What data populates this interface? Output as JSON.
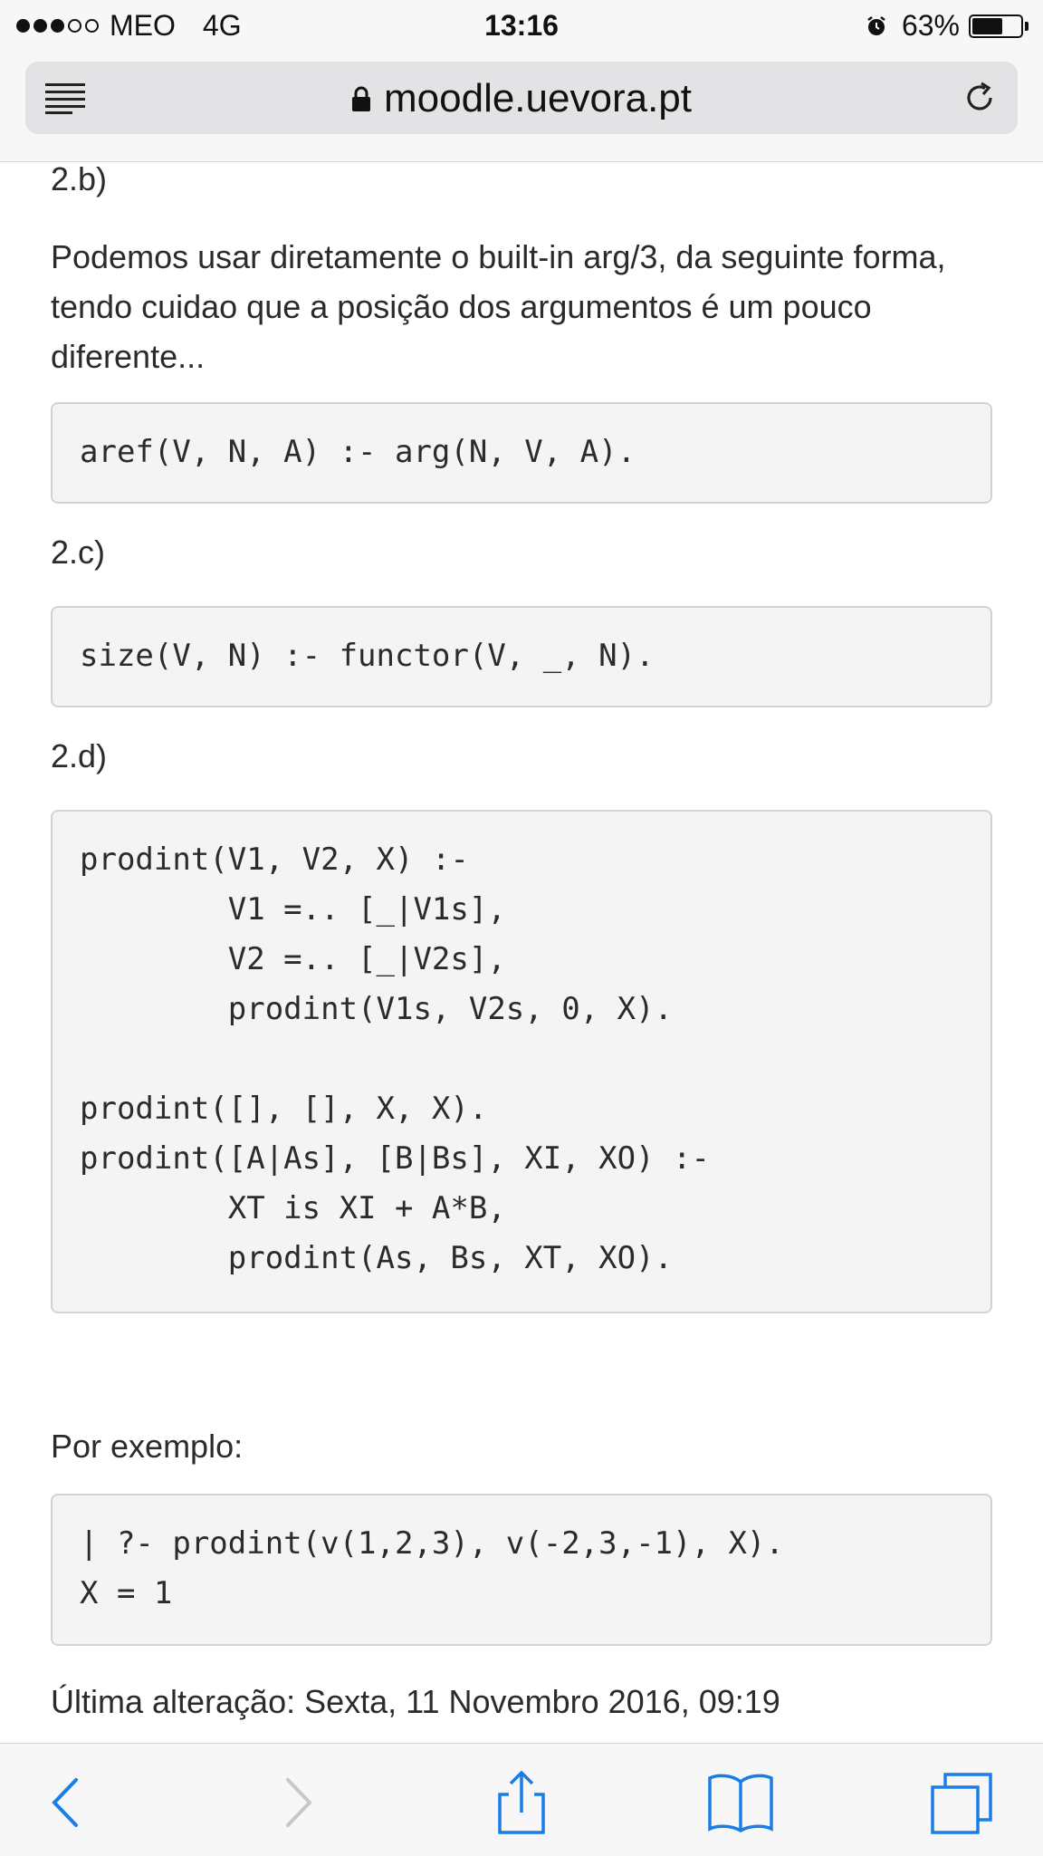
{
  "status_bar": {
    "carrier": "MEO",
    "network": "4G",
    "time": "13:16",
    "battery_percent": "63%",
    "battery_level": 0.63,
    "signal_bars_filled": 3,
    "signal_bars_total": 5
  },
  "url_bar": {
    "domain": "moodle.uevora.pt"
  },
  "content": {
    "heading_2b": "2.b)",
    "paragraph_2b": "Podemos usar diretamente o built-in arg/3, da seguinte forma, tendo cuidao que a posição dos argumentos é um pouco diferente...",
    "code_2b": "aref(V, N, A) :- arg(N, V, A).",
    "heading_2c": "2.c)",
    "code_2c": "size(V, N) :- functor(V, _, N).",
    "heading_2d": "2.d)",
    "code_2d": "prodint(V1, V2, X) :-\n        V1 =.. [_|V1s],\n        V2 =.. [_|V2s],\n        prodint(V1s, V2s, 0, X).\n\nprodint([], [], X, X).\nprodint([A|As], [B|Bs], XI, XO) :-\n        XT is XI + A*B,\n        prodint(As, Bs, XT, XO).",
    "example_label": "Por exemplo:",
    "code_example": "| ?- prodint(v(1,2,3), v(-2,3,-1), X).\nX = 1",
    "last_modified": "Última alteração: Sexta, 11 Novembro 2016, 09:19"
  },
  "colors": {
    "accent": "#1a7ee6",
    "disabled": "#c8c8cc",
    "code_bg": "#f4f4f5"
  }
}
